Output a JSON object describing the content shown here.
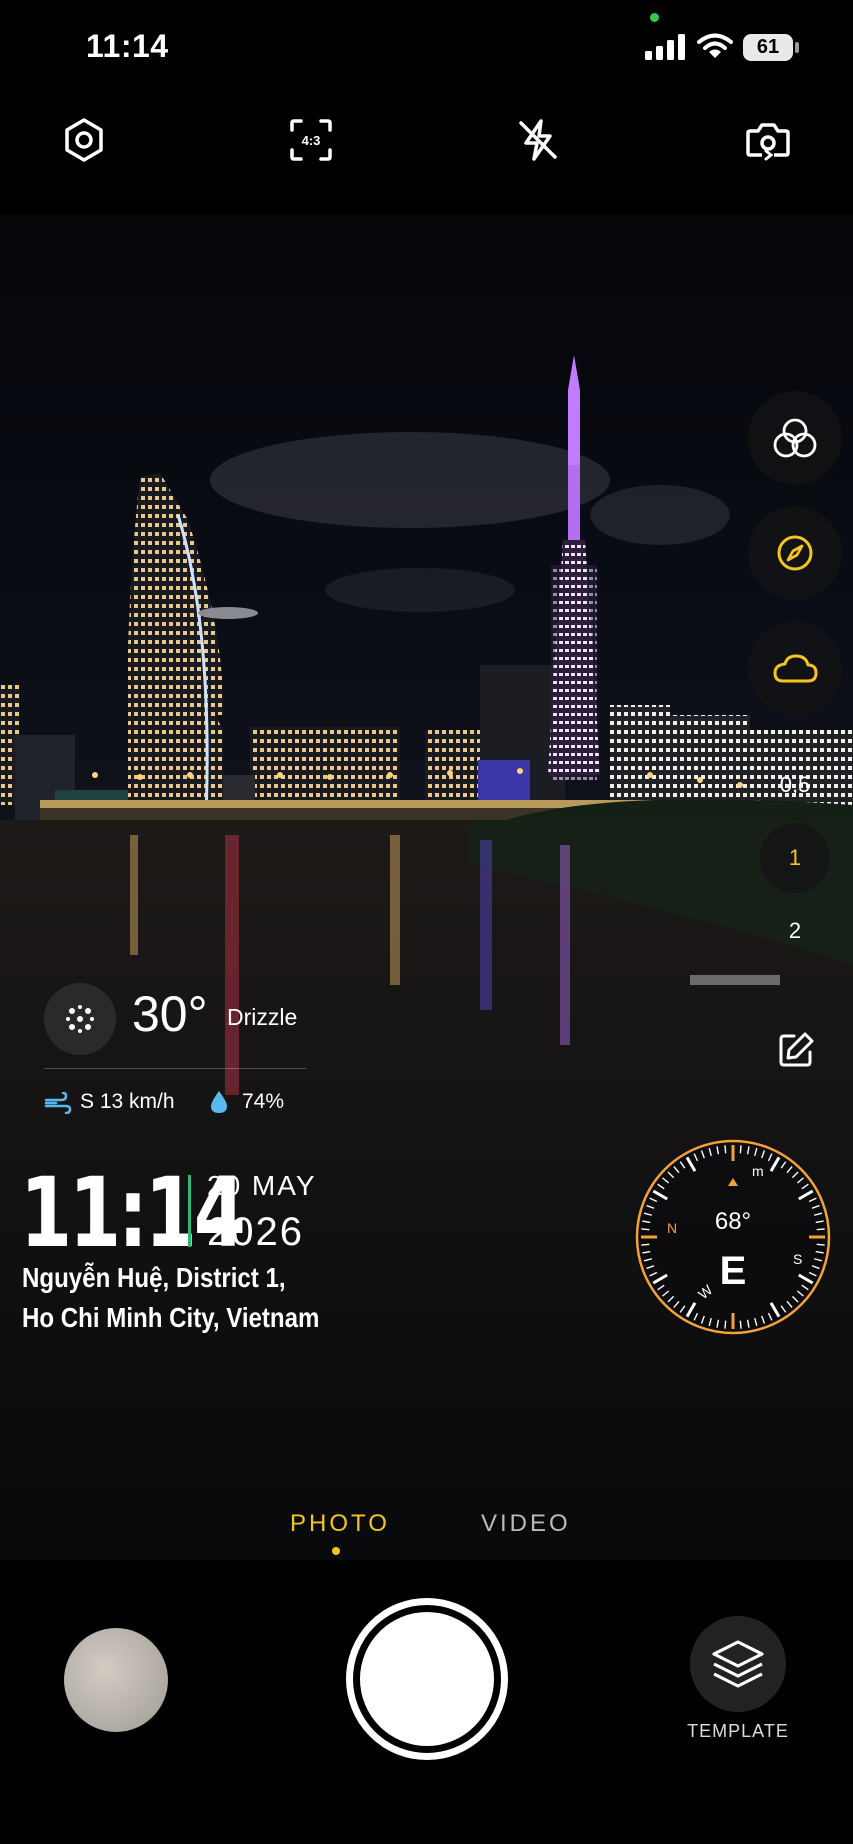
{
  "status_bar": {
    "time": "11:14",
    "battery": "61"
  },
  "top_toolbar": {
    "aspect_ratio": "4:3"
  },
  "side_controls": {
    "zoom_levels": [
      "0,5",
      "1",
      "2"
    ],
    "active_zoom": "1",
    "accent_color": "#f3c51e"
  },
  "weather": {
    "temperature": "30°",
    "condition": "Drizzle",
    "wind": "S 13 km/h",
    "humidity": "74%"
  },
  "stamp": {
    "time": "11:14",
    "day_month": "20 MAY",
    "year": "2026",
    "address_line1": "Nguyễn Huệ, District 1,",
    "address_line2": "Ho Chi Minh City, Vietnam"
  },
  "compass": {
    "degrees": "68°",
    "direction": "E",
    "marks": [
      "N",
      "S",
      "W",
      "m"
    ]
  },
  "modes": {
    "photo": "PHOTO",
    "video": "VIDEO",
    "active": "PHOTO"
  },
  "bottom": {
    "template_label": "TEMPLATE"
  }
}
